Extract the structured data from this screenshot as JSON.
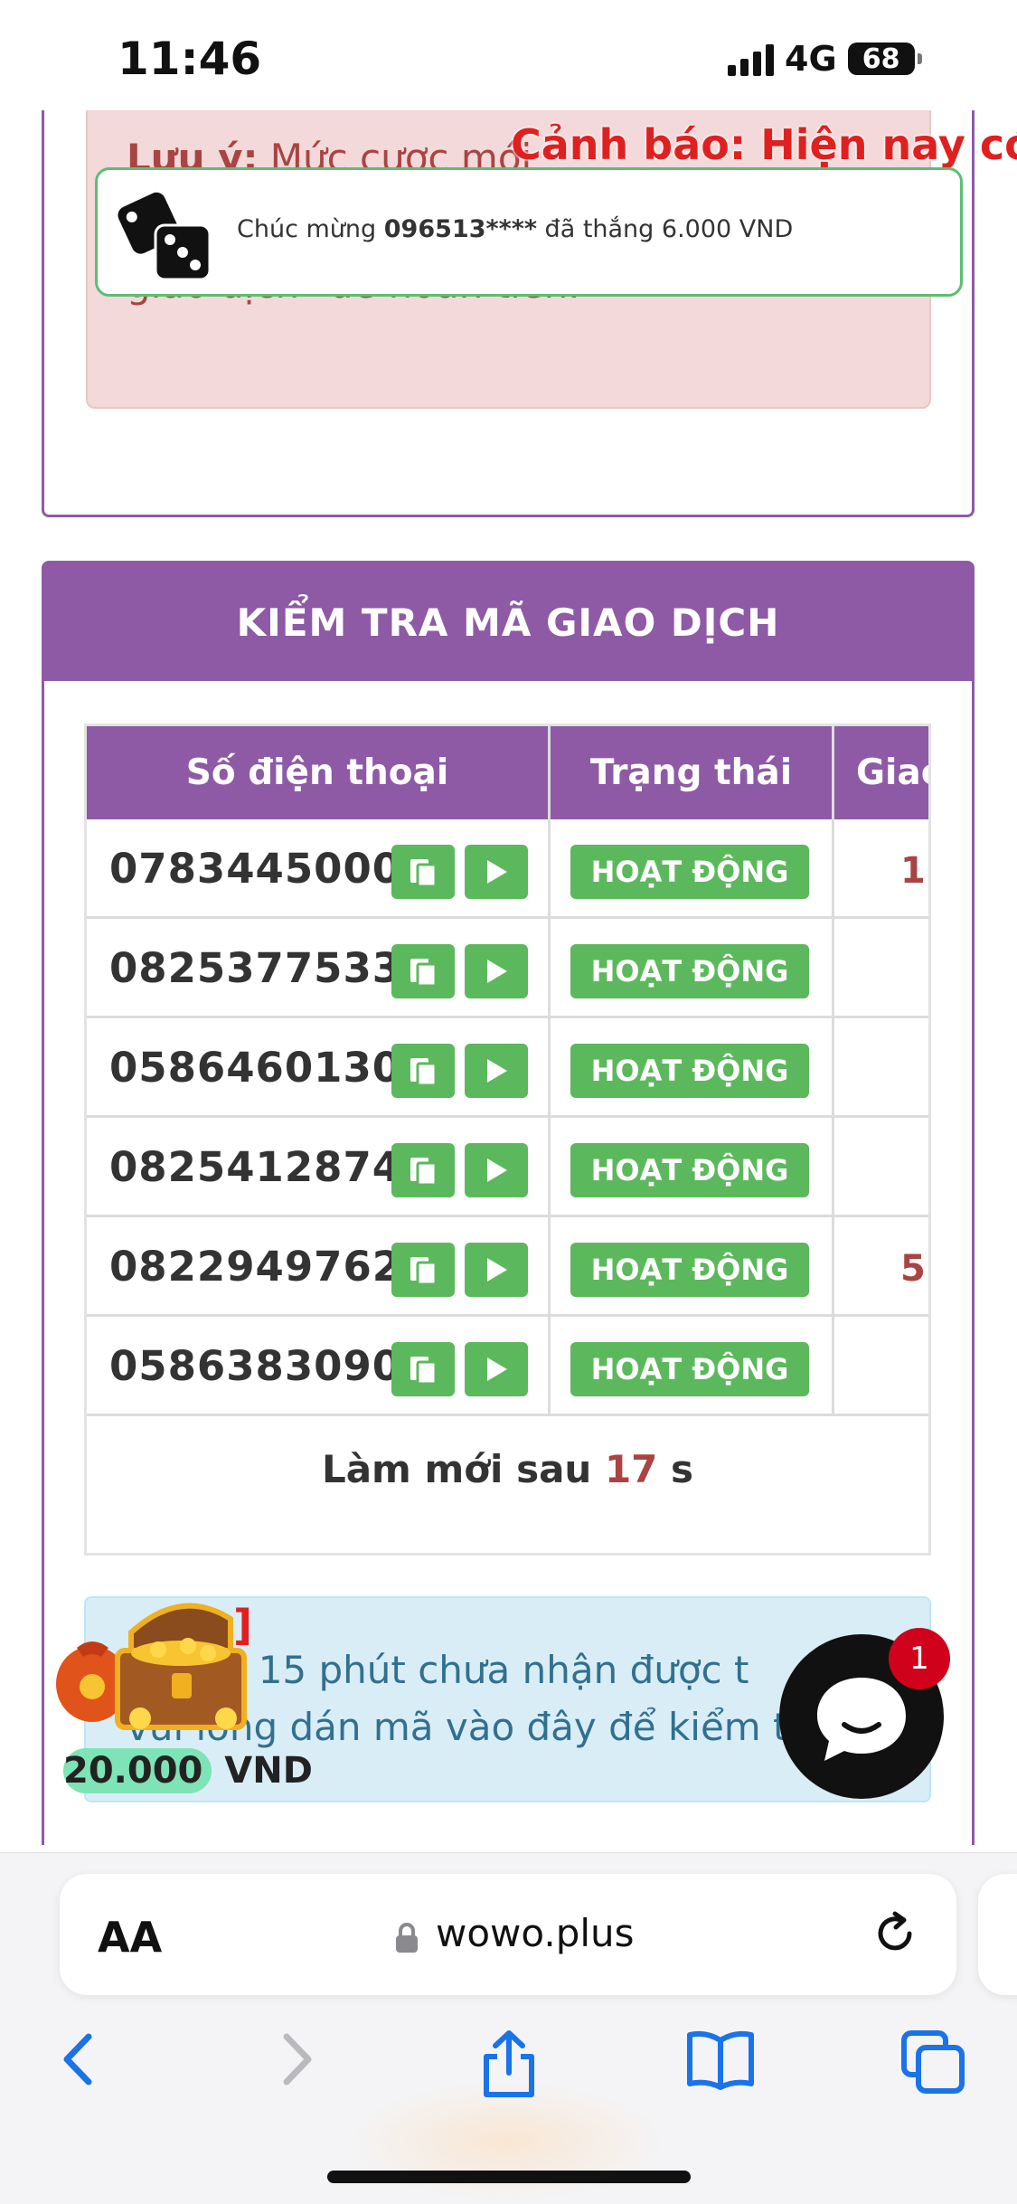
{
  "status_bar": {
    "time": "11:46",
    "network": "4G",
    "battery": "68"
  },
  "note": {
    "label": "Lưu ý:",
    "line1_text": " Mức cược mới",
    "line2": "giao dịch\" để hoàn tiền."
  },
  "ticker": "Cảnh báo: Hiện nay có",
  "toast": {
    "prefix": "Chúc mừng ",
    "phone": "096513****",
    "suffix": " đã thắng 6.000 VND"
  },
  "check_section": {
    "title": "KIỂM TRA MÃ GIAO DỊCH",
    "columns": [
      "Số điện thoại",
      "Trạng thái",
      "Giao"
    ],
    "rows": [
      {
        "phone": "0783445000",
        "status": "HOẠT ĐỘNG",
        "giao": "1"
      },
      {
        "phone": "0825377533",
        "status": "HOẠT ĐỘNG",
        "giao": ""
      },
      {
        "phone": "0586460130",
        "status": "HOẠT ĐỘNG",
        "giao": ""
      },
      {
        "phone": "0825412874",
        "status": "HOẠT ĐỘNG",
        "giao": ""
      },
      {
        "phone": "0822949762",
        "status": "HOẠT ĐỘNG",
        "giao": "5"
      },
      {
        "phone": "0586383090",
        "status": "HOẠT ĐỘNG",
        "giao": ""
      }
    ],
    "refresh_prefix": "Làm mới sau ",
    "refresh_seconds": "17",
    "refresh_suffix": " s"
  },
  "info": {
    "bracket": "]",
    "line1": "uá 15 phút chưa nhận được t",
    "line2": "vui lòng dán mã vào đây để kiểm t",
    "win_amount": "20.000",
    "win_currency": " VND"
  },
  "chat": {
    "badge": "1"
  },
  "browser": {
    "aa_label": "AA",
    "url": "wowo.plus"
  },
  "colors": {
    "purple": "#8e5aa5",
    "green": "#5cb85c",
    "danger_text": "#a94442",
    "info_text": "#31708f"
  }
}
